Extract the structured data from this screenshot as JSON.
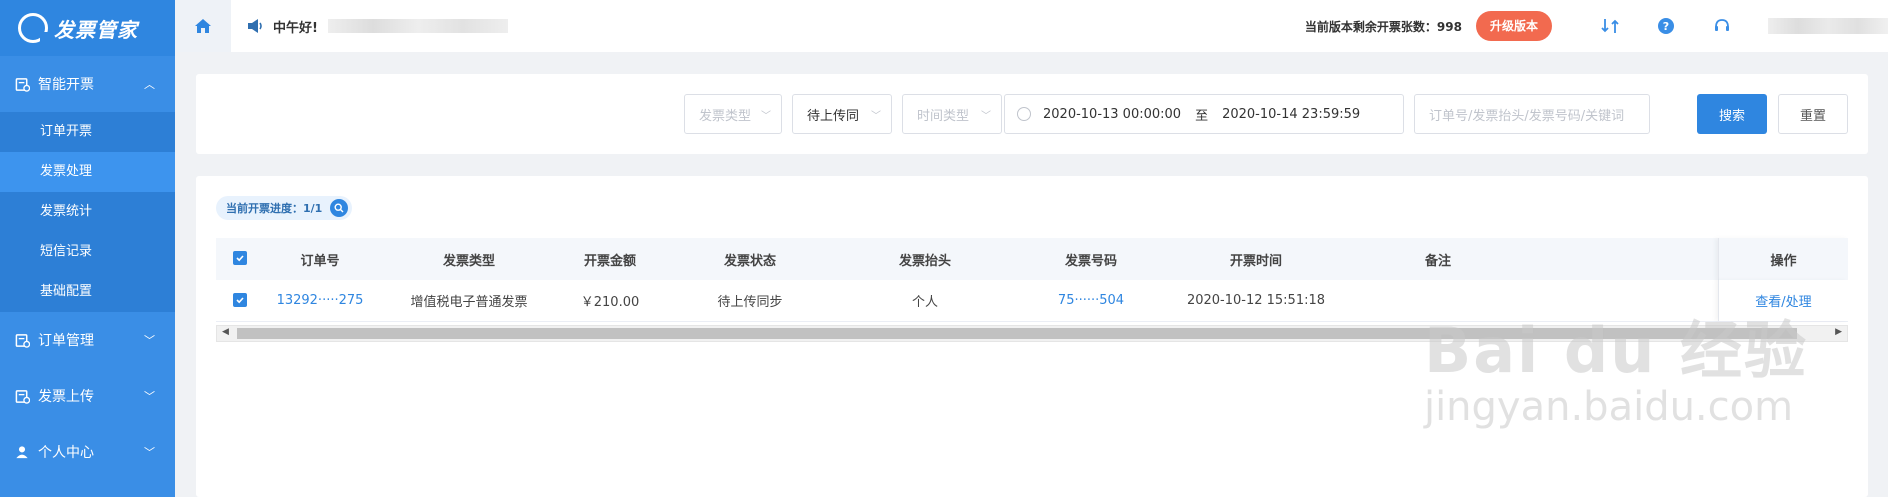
{
  "app": {
    "logo_text": "发票管家"
  },
  "sidebar": {
    "groups": [
      {
        "label": "智能开票",
        "icon": "invoice-icon",
        "open": true,
        "items": [
          {
            "label": "订单开票"
          },
          {
            "label": "发票处理",
            "active": true
          },
          {
            "label": "发票统计"
          },
          {
            "label": "短信记录"
          },
          {
            "label": "基础配置"
          }
        ]
      },
      {
        "label": "订单管理",
        "icon": "order-icon",
        "open": false
      },
      {
        "label": "发票上传",
        "icon": "upload-icon",
        "open": false
      },
      {
        "label": "个人中心",
        "icon": "user-icon",
        "open": false
      }
    ]
  },
  "topbar": {
    "greeting": "中午好!",
    "quota_text": "当前版本剩余开票张数：998",
    "upgrade_label": "升级版本"
  },
  "search": {
    "invoice_type_placeholder": "发票类型",
    "status_value": "待上传同",
    "time_type_placeholder": "时间类型",
    "date_start": "2020-10-13 00:00:00",
    "date_sep": "至",
    "date_end": "2020-10-14 23:59:59",
    "keyword_placeholder": "订单号/发票抬头/发票号码/关键词",
    "search_label": "搜索",
    "reset_label": "重置"
  },
  "progress": {
    "label": "当前开票进度：1/1"
  },
  "table": {
    "headers": [
      "订单号",
      "发票类型",
      "开票金额",
      "发票状态",
      "发票抬头",
      "发票号码",
      "开票时间",
      "备注",
      "操作"
    ],
    "rows": [
      {
        "order_no": "13292·····275",
        "invoice_type": "增值税电子普通发票",
        "amount": "￥210.00",
        "status": "待上传同步",
        "title": "个人",
        "invoice_no": "75······504",
        "time": "2020-10-12 15:51:18",
        "remark": "",
        "action": "查看/处理"
      }
    ]
  },
  "watermark": {
    "brand": "Bai du 经验",
    "url": "jingyan.baidu.com"
  },
  "colors": {
    "sidebar": "#3a8ee6",
    "primary": "#2f86e0",
    "upgrade": "#f26a4f"
  }
}
